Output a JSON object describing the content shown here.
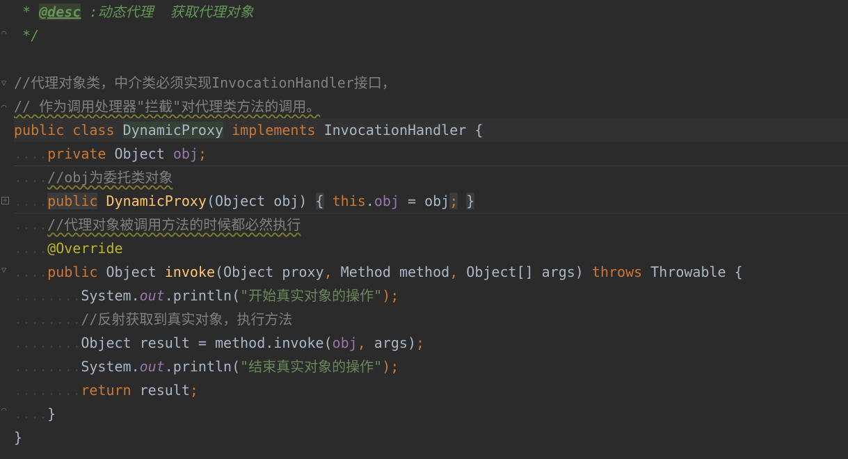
{
  "editor": {
    "colors": {
      "background": "#2b2b2b",
      "keyword": "#cc7832",
      "string": "#6a8759",
      "comment": "#808080",
      "doc": "#629755",
      "method": "#ffc66d",
      "field": "#9876aa",
      "annotation": "#bbb529",
      "text": "#a9b7c6"
    },
    "lines": {
      "l1": {
        "star": " * ",
        "tag": "@desc",
        "text": " :动态代理  获取代理对象"
      },
      "l2": {
        "text": " */"
      },
      "l3": {
        "text": ""
      },
      "l4": {
        "text": "//代理对象类，中介类必须实现InvocationHandler接口，"
      },
      "l5": {
        "text": "// 作为调用处理器\"拦截\"对代理类方法的调用。"
      },
      "l6": {
        "kw1": "public",
        "kw2": "class",
        "cls": "DynamicProxy",
        "kw3": "implements",
        "iface": "InvocationHandler",
        "brace": "{"
      },
      "l7": {
        "kw": "private",
        "type": "Object",
        "field": "obj",
        "semi": ";"
      },
      "l8": {
        "text": "//obj为委托类对象"
      },
      "l9": {
        "kw": "public",
        "ctor": "DynamicProxy",
        "params": "(Object obj)",
        "ob": "{",
        "this": "this",
        "dot": ".",
        "field": "obj",
        "assign": " = obj",
        "semi": ";",
        "cb": "}"
      },
      "l10": {
        "text": "//代理对象被调用方法的时候都必然执行"
      },
      "l11": {
        "ann": "@Override"
      },
      "l12": {
        "kw": "public",
        "type": "Object",
        "method": "invoke",
        "p1": "(Object proxy",
        "c1": ",",
        "p2": " Method method",
        "c2": ",",
        "p3": " Object[] args)",
        "throws": "throws",
        "exc": "Throwable",
        "brace": "{"
      },
      "l13": {
        "obj": "System.",
        "out": "out",
        "call": ".println(",
        "str": "\"开始真实对象的操作\"",
        "end": ");"
      },
      "l14": {
        "text": "//反射获取到真实对象，执行方法"
      },
      "l15": {
        "decl": "Object result = method.invoke(",
        "field": "obj",
        "comma": ",",
        "args": " args)",
        "semi": ";"
      },
      "l16": {
        "obj": "System.",
        "out": "out",
        "call": ".println(",
        "str": "\"结束真实对象的操作\"",
        "end": ");"
      },
      "l17": {
        "kw": "return",
        "rest": " result",
        "semi": ";"
      },
      "l18": {
        "text": "}"
      },
      "l19": {
        "text": "}"
      }
    }
  }
}
